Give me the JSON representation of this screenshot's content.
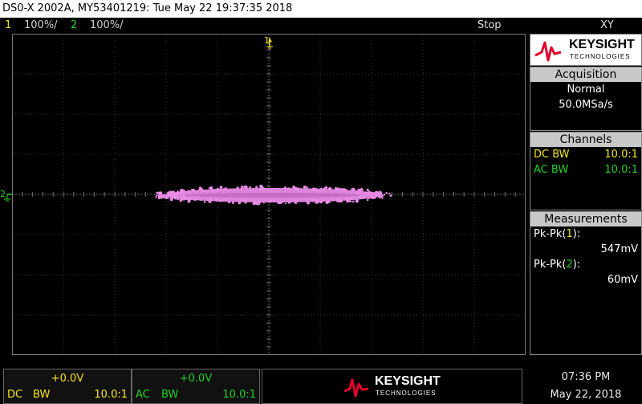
{
  "titlebar": {
    "text": "DS0-X 2002A, MY53401219: Tue May 22 19:37:35 2018"
  },
  "channels_bar": {
    "ch1_num": "1",
    "ch1_scale": "100%/",
    "ch2_num": "2",
    "ch2_scale": "100%/",
    "run_state": "Stop",
    "mode": "XY"
  },
  "screen": {
    "top_marker": "1",
    "left_marker": "2",
    "trace_color": "#e88ae6"
  },
  "sidebar": {
    "logo": {
      "brand": "KEYSIGHT",
      "sub": "TECHNOLOGIES"
    },
    "acquisition": {
      "title": "Acquisition",
      "mode": "Normal",
      "rate": "50.0MSa/s"
    },
    "channels": {
      "title": "Channels",
      "rows": [
        {
          "coupling": "DC BW",
          "probe": "10.0:1"
        },
        {
          "coupling": "AC BW",
          "probe": "10.0:1"
        }
      ]
    },
    "measurements": {
      "title": "Measurements",
      "m1_prefix": "Pk-Pk(",
      "m1_ch": "1",
      "m1_suffix": "):",
      "m1_value": "547mV",
      "m2_prefix": "Pk-Pk(",
      "m2_ch": "2",
      "m2_suffix": "):",
      "m2_value": "60mV"
    }
  },
  "bottom": {
    "ch1": {
      "offset": "+0.0V",
      "coupling": "DC",
      "bw": "BW",
      "probe": "10.0:1"
    },
    "ch2": {
      "offset": "+0.0V",
      "coupling": "AC",
      "bw": "BW",
      "probe": "10.0:1"
    },
    "logo": {
      "brand": "KEYSIGHT",
      "sub": "TECHNOLOGIES"
    },
    "time": "07:36 PM",
    "date": "May 22, 2018"
  },
  "colors": {
    "ch1": "#f7e51a",
    "ch2": "#21d327",
    "keysight_red": "#e4002b"
  }
}
